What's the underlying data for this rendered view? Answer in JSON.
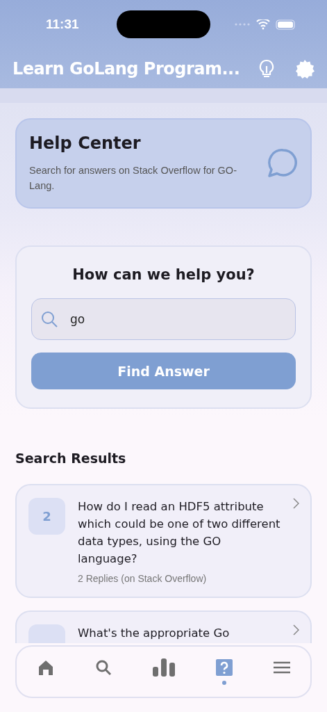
{
  "status_bar": {
    "time": "11:31"
  },
  "header": {
    "title": "Learn GoLang Program..."
  },
  "help_card": {
    "title": "Help Center",
    "description": "Search for answers on Stack Overflow for GO-Lang."
  },
  "search_card": {
    "title": "How can we help you?",
    "search": {
      "value": "go"
    },
    "button": "Find Answer"
  },
  "results": {
    "title": "Search Results",
    "items": [
      {
        "count": "2",
        "question": "How do I read an HDF5 attribute which could be one of two different data types, using the GO language?",
        "meta": "2 Replies (on Stack Overflow)"
      },
      {
        "question": "What's the appropriate Go"
      }
    ]
  },
  "tabs": [
    {
      "kind": "home",
      "selected": false
    },
    {
      "kind": "search",
      "selected": false
    },
    {
      "kind": "stats",
      "selected": false
    },
    {
      "kind": "help",
      "selected": true
    },
    {
      "kind": "menu",
      "selected": false
    }
  ]
}
